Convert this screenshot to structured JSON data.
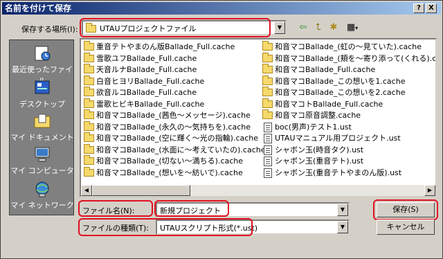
{
  "window": {
    "title": "名前を付けて保存"
  },
  "title_buttons": {
    "help": "?",
    "close": "X"
  },
  "save_in": {
    "label": "保存する場所(I):",
    "value": "UTAUプロジェクトファイル"
  },
  "toolbar": {
    "icons": [
      "back-icon",
      "up-folder-icon",
      "new-folder-icon",
      "view-menu-icon"
    ]
  },
  "places": [
    {
      "label": "最近使ったファイル",
      "icon": "recent-icon"
    },
    {
      "label": "デスクトップ",
      "icon": "desktop-icon"
    },
    {
      "label": "マイ ドキュメント",
      "icon": "my-documents-icon"
    },
    {
      "label": "マイ コンピュータ",
      "icon": "my-computer-icon"
    },
    {
      "label": "マイ ネットワーク",
      "icon": "my-network-icon"
    }
  ],
  "files_col1": [
    {
      "name": "重音テトやまのん版Ballade_Full.cache",
      "type": "folder"
    },
    {
      "name": "雪歌ユフBallade_Full.cache",
      "type": "folder"
    },
    {
      "name": "天音ルナBallade_Full.cache",
      "type": "folder"
    },
    {
      "name": "白音ヒヨリBallade_Full.cache",
      "type": "folder"
    },
    {
      "name": "欲音ルコBallade_Full.cache",
      "type": "folder"
    },
    {
      "name": "雷歌ヒビキBallade_Full.cache",
      "type": "folder"
    },
    {
      "name": "和音マコBallade_(茜色〜メッセージ).cache",
      "type": "folder"
    },
    {
      "name": "和音マコBallade_(永久の〜気持ちを).cache",
      "type": "folder"
    },
    {
      "name": "和音マコBallade_(空に輝く〜光の指輪).cache",
      "type": "folder"
    },
    {
      "name": "和音マコBallade_(水面に〜考えていたの).cache",
      "type": "folder"
    },
    {
      "name": "和音マコBallade_(切ない〜満ちる).cache",
      "type": "folder"
    },
    {
      "name": "和音マコBallade_(想いを〜紡いで).cache",
      "type": "folder"
    }
  ],
  "files_col2": [
    {
      "name": "和音マコBallade_(虹の〜見ていた).cache",
      "type": "folder"
    },
    {
      "name": "和音マコBallade_(頬を〜寄り添って(くれる).cache",
      "type": "folder"
    },
    {
      "name": "和音マコBallade_Full.cache",
      "type": "folder"
    },
    {
      "name": "和音マコBallade_この想いを1.cache",
      "type": "folder"
    },
    {
      "name": "和音マコBallade_この想いを2.cache",
      "type": "folder"
    },
    {
      "name": "和音マコトBallade_Full.cache",
      "type": "folder"
    },
    {
      "name": "和音マコ原音調整.cache",
      "type": "folder"
    },
    {
      "name": "boc(男声)テスト1.ust",
      "type": "file"
    },
    {
      "name": "UTAUマニュアル用プロジェクト.ust",
      "type": "file"
    },
    {
      "name": "シャボン玉(時音タク).ust",
      "type": "file"
    },
    {
      "name": "シャボン玉(重音テト).ust",
      "type": "file"
    },
    {
      "name": "シャボン玉(重音テトやまのん版).ust",
      "type": "file"
    }
  ],
  "filename": {
    "label": "ファイル名(N):",
    "value": "新規プロジェクト"
  },
  "filetype": {
    "label": "ファイルの種類(T):",
    "value": "UTAUスクリプト形式(*.ust)"
  },
  "buttons": {
    "save": "保存(S)",
    "cancel": "キャンセル"
  },
  "colors": {
    "highlight": "#e01020",
    "titlebar": "#0a246a",
    "dialog_bg": "#d4d0c8",
    "places_bg": "#808080"
  }
}
